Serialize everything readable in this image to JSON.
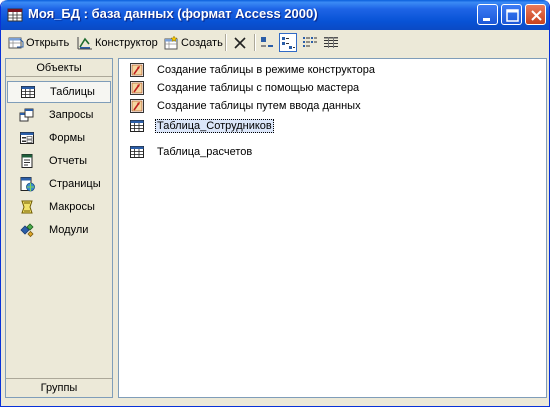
{
  "window": {
    "title": "Моя_БД : база данных (формат Access 2000)"
  },
  "toolbar": {
    "open_label": "Открыть",
    "design_label": "Конструктор",
    "create_label": "Создать"
  },
  "sidebar": {
    "header": "Объекты",
    "footer": "Группы",
    "items": [
      {
        "label": "Таблицы",
        "icon": "table-icon"
      },
      {
        "label": "Запросы",
        "icon": "query-icon"
      },
      {
        "label": "Формы",
        "icon": "form-icon"
      },
      {
        "label": "Отчеты",
        "icon": "report-icon"
      },
      {
        "label": "Страницы",
        "icon": "page-icon"
      },
      {
        "label": "Макросы",
        "icon": "macro-icon"
      },
      {
        "label": "Модули",
        "icon": "module-icon"
      }
    ]
  },
  "content": {
    "items": [
      {
        "label": "Создание таблицы в режиме конструктора",
        "icon": "shortcut-icon"
      },
      {
        "label": "Создание таблицы с помощью мастера",
        "icon": "shortcut-icon"
      },
      {
        "label": "Создание таблицы путем ввода данных",
        "icon": "shortcut-icon"
      },
      {
        "label": "Таблица_Сотрудников",
        "icon": "table-icon"
      },
      {
        "label": "Таблица_расчетов",
        "icon": "table-icon"
      }
    ]
  }
}
